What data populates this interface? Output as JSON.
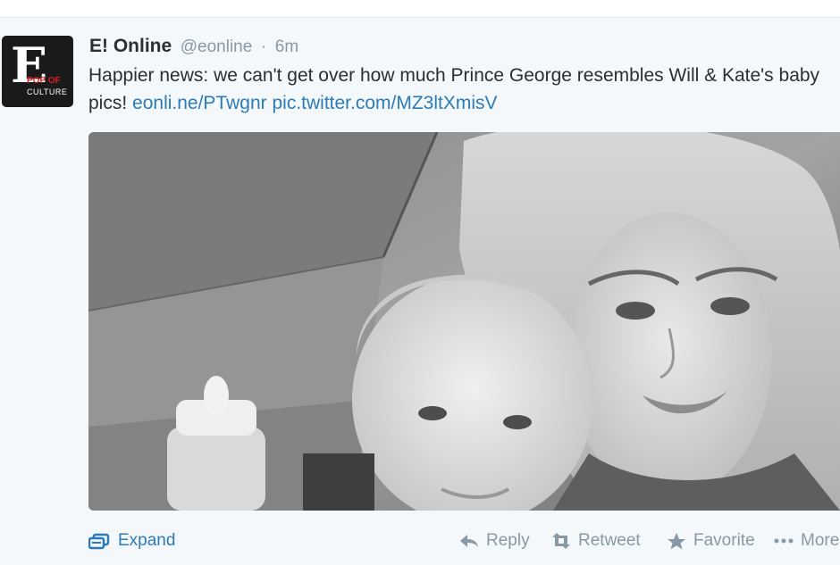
{
  "tweet": {
    "name": "E! Online",
    "handle": "@eonline",
    "separator": "·",
    "time": "6m",
    "text_part1": "Happier news: we can't get over how much Prince George resembles Will & Kate's baby pics!",
    "link1": "eonli.ne/PTwgnr",
    "link2": "pic.twitter.com/MZ3ltXmisV"
  },
  "avatar": {
    "logo_letter": "E",
    "logo_line1": "POP OF",
    "logo_line2": "CULTURE"
  },
  "actions": {
    "expand": "Expand",
    "reply": "Reply",
    "retweet": "Retweet",
    "favorite": "Favorite",
    "more": "More"
  },
  "colors": {
    "link": "#2b7bb9",
    "muted": "#8899a6",
    "text": "#292f33",
    "background": "#f5f8fa"
  },
  "icons": {
    "expand": "expand-icon",
    "reply": "reply-arrow-icon",
    "retweet": "retweet-icon",
    "favorite": "star-icon",
    "more": "ellipsis-icon"
  }
}
